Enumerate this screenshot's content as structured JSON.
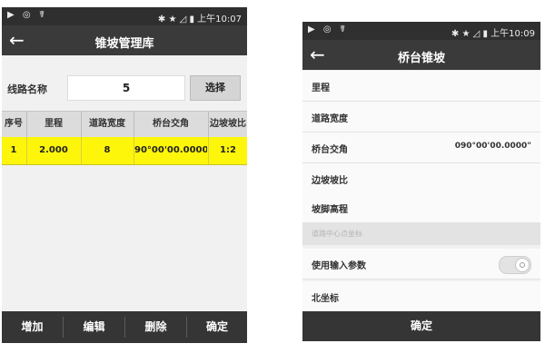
{
  "left_screen": {
    "status": {
      "icons_left": "▶ ◎ ☤",
      "icons_right": "✱ ★ ◿ ▮",
      "time": "上午10:07"
    },
    "appbar": {
      "back": "←",
      "title": "锥坡管理库"
    },
    "route": {
      "label": "线路名称",
      "value": "5",
      "select_button": "选择"
    },
    "table": {
      "headers": [
        "序号",
        "里程",
        "道路宽度",
        "桥台交角",
        "边坡坡比"
      ],
      "rows": [
        {
          "no": "1",
          "mileage": "2.000",
          "width": "8",
          "angle": "90°00'00.0000\"",
          "slope": "1:2"
        }
      ],
      "selected_row_color": "#fdf60a"
    },
    "bottom_buttons": [
      "增加",
      "编辑",
      "删除",
      "确定"
    ]
  },
  "right_screen": {
    "status": {
      "icons_left": "▶ ◎ ☤",
      "icons_right": "✱ ★ ◿ ▮",
      "time": "上午10:09"
    },
    "appbar": {
      "back": "←",
      "title": "桥台锥坡"
    },
    "fields": [
      {
        "label": "里程",
        "value": ""
      },
      {
        "label": "道路宽度",
        "value": ""
      },
      {
        "label": "桥台交角",
        "value": "090°00'00.0000\""
      },
      {
        "label": "边坡坡比",
        "value": ""
      },
      {
        "label": "坡脚高程",
        "value": ""
      }
    ],
    "section_header": "道路中心点坐标",
    "toggle": {
      "label": "使用输入参数",
      "on": false
    },
    "north": {
      "label": "北坐标"
    },
    "confirm_button": "确定"
  }
}
